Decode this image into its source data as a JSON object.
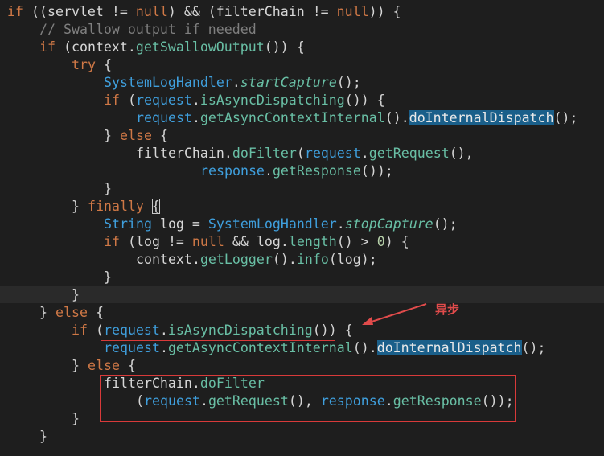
{
  "annotation": {
    "label": "异步",
    "color": "#e04b4b"
  },
  "colors": {
    "background": "#1e1e1e",
    "keyword": "#cf7846",
    "comment": "#7f7f7f",
    "method": "#69bfa5",
    "identifier_blue": "#3f9fdd",
    "highlight_box": "#d93a3a",
    "selection": "#1a5f8a"
  },
  "code": {
    "l1": {
      "kw": "if",
      "a": " ((",
      "v1": "servlet",
      "b": " != ",
      "k2": "null",
      "c": ") && (",
      "v2": "filterChain",
      "d": " != ",
      "k3": "null",
      "e": ")) {"
    },
    "l2": {
      "comment": "// Swallow output if needed"
    },
    "l3": {
      "kw": "if",
      "a": " (",
      "v": "context",
      "dot": ".",
      "m": "getSwallowOutput",
      "e": "()) {"
    },
    "l4": {
      "kw": "try",
      "e": " {"
    },
    "l5": {
      "cls": "SystemLogHandler",
      "dot": ".",
      "m": "startCapture",
      "e": "();"
    },
    "l6": {
      "kw": "if",
      "a": " (",
      "v": "request",
      "dot": ".",
      "m": "isAsyncDispatching",
      "e": "()) {"
    },
    "l7": {
      "v": "request",
      "dot": ".",
      "m": "getAsyncContextInternal",
      "mid": "().",
      "m2": "doInternalDispatch",
      "e": "();"
    },
    "l8": {
      "a": "} ",
      "kw": "else",
      "e": " {"
    },
    "l9": {
      "v": "filterChain",
      "dot": ".",
      "m": "doFilter",
      "a": "(",
      "v2": "request",
      "dot2": ".",
      "m2": "getRequest",
      "e": "(),"
    },
    "l10": {
      "v": "response",
      "dot": ".",
      "m": "getResponse",
      "e": "());"
    },
    "l11": {
      "e": "}"
    },
    "l12": {
      "a": "} ",
      "kw": "finally",
      "sp": " ",
      "brace": "{"
    },
    "l13": {
      "cls": "String",
      "sp": " ",
      "v": "log",
      "a": " = ",
      "cls2": "SystemLogHandler",
      "dot": ".",
      "m": "stopCapture",
      "e": "();"
    },
    "l14": {
      "kw": "if",
      "a": " (",
      "v": "log",
      "b": " != ",
      "k2": "null",
      "c": " && ",
      "v2": "log",
      "dot": ".",
      "m": "length",
      "d": "() > ",
      "num": "0",
      "e": ") {"
    },
    "l15": {
      "v": "context",
      "dot": ".",
      "m": "getLogger",
      "mid": "().",
      "m2": "info",
      "a": "(",
      "v2": "log",
      "e": ");"
    },
    "l16": {
      "e": "}"
    },
    "l17": {
      "e": "}"
    },
    "l18": {
      "a": "} ",
      "kw": "else",
      "e": " {"
    },
    "l19": {
      "kw": "if",
      "a": " (",
      "v": "request",
      "dot": ".",
      "m": "isAsyncDispatching",
      "e": "()) {"
    },
    "l20": {
      "v": "request",
      "dot": ".",
      "m": "getAsyncContextInternal",
      "mid": "().",
      "m2": "doInternalDispatch",
      "e": "();"
    },
    "l21": {
      "a": "} ",
      "kw": "else",
      "e": " {"
    },
    "l22": {
      "v": "filterChain",
      "dot": ".",
      "m": "doFilter"
    },
    "l23": {
      "a": "(",
      "v": "request",
      "dot": ".",
      "m": "getRequest",
      "b": "(), ",
      "v2": "response",
      "dot2": ".",
      "m2": "getResponse",
      "e": "());"
    },
    "l24": {
      "e": "}"
    },
    "l25": {
      "e": "}"
    }
  }
}
